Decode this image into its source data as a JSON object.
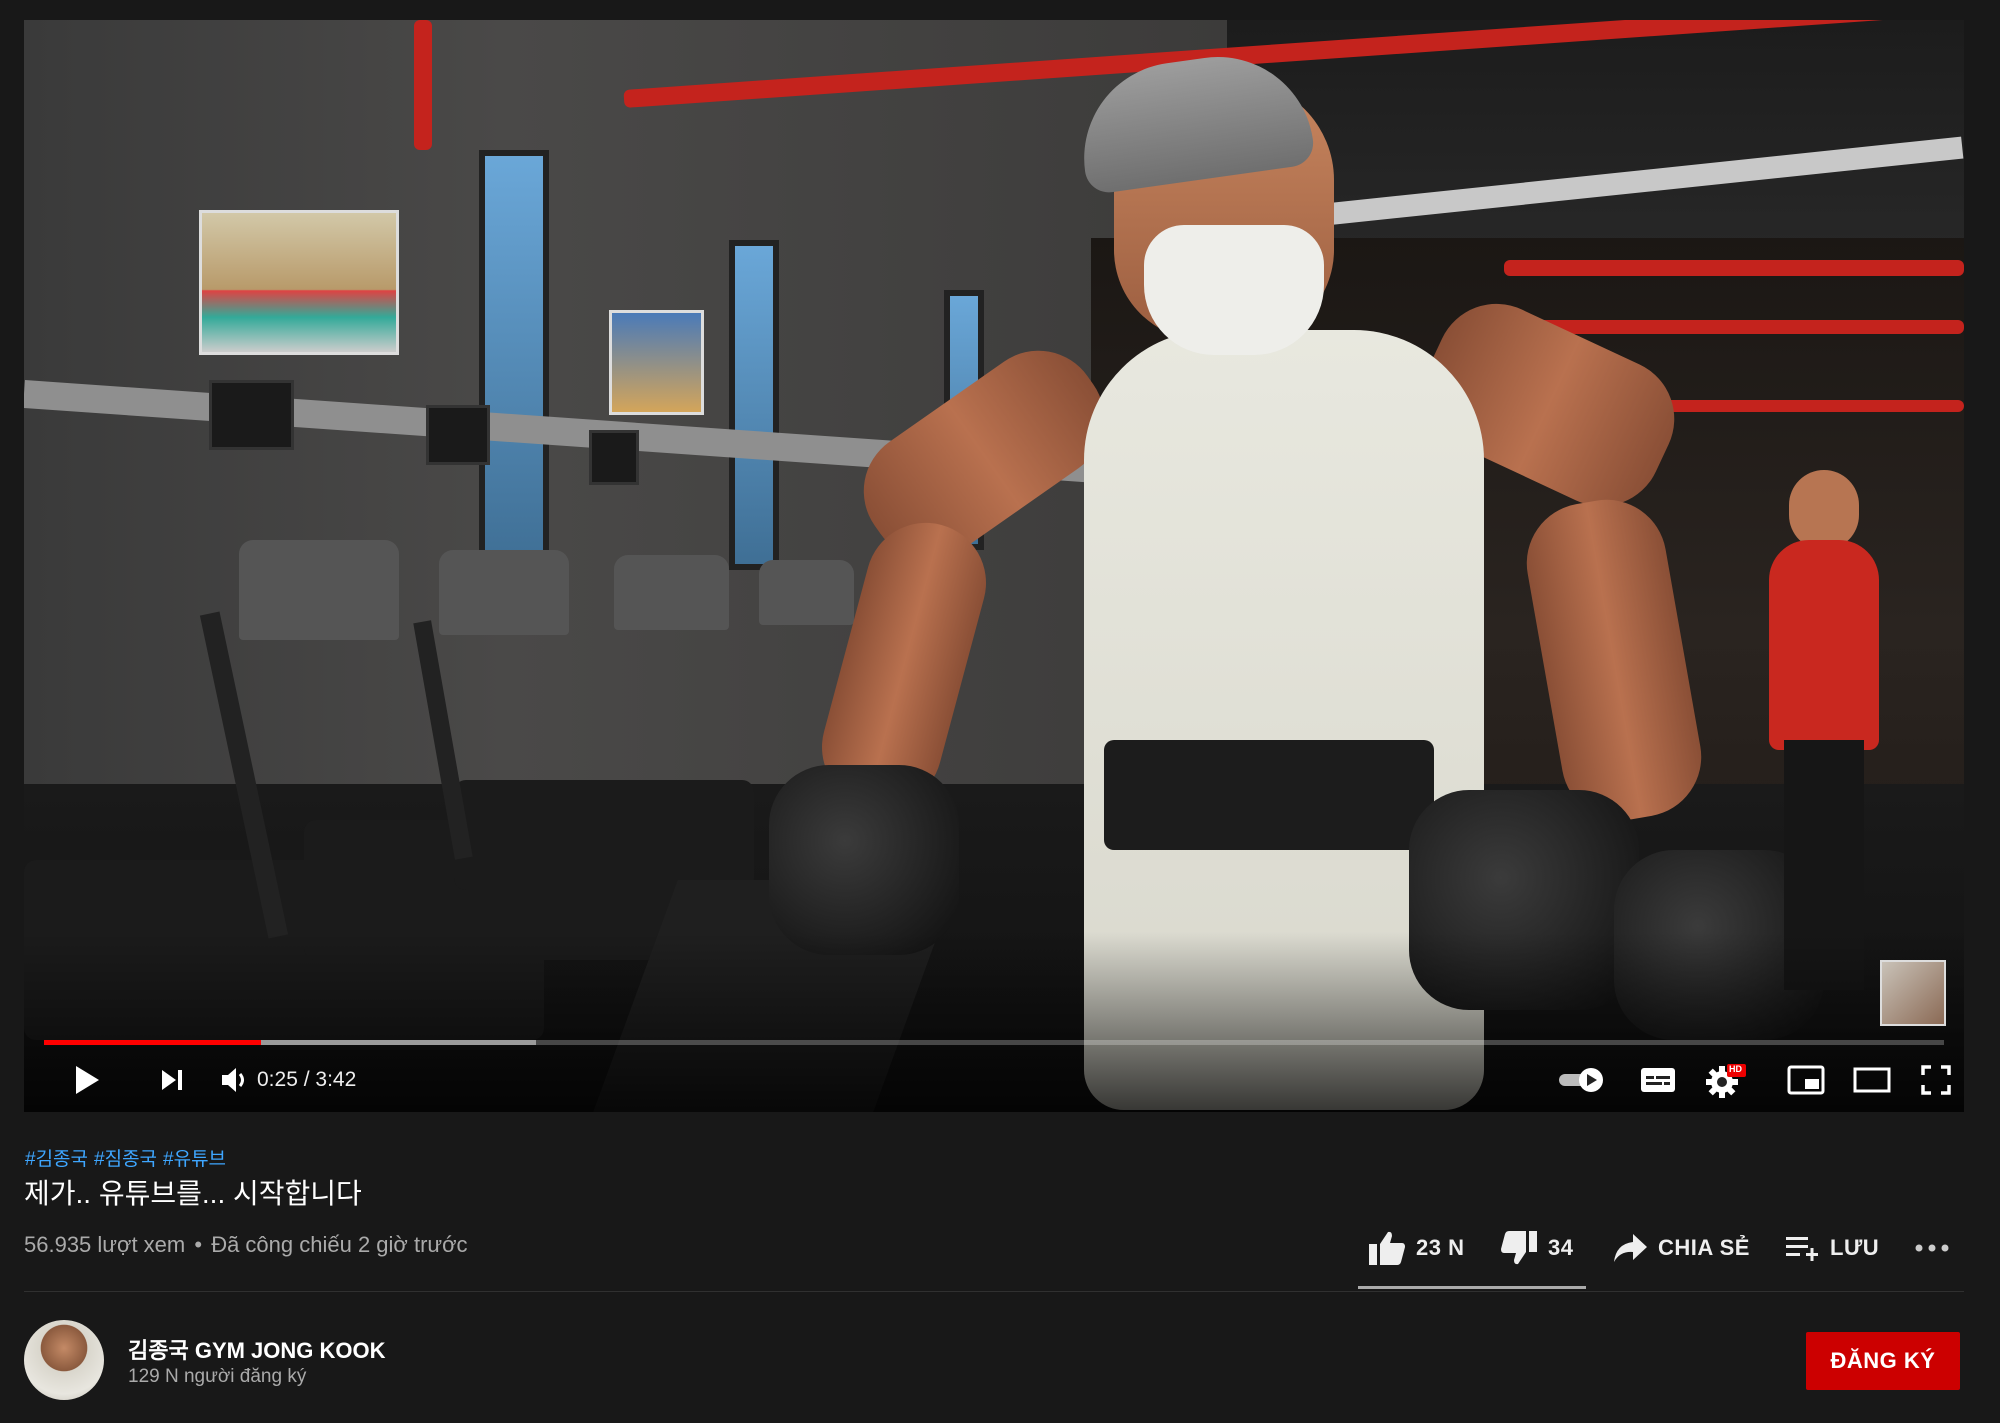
{
  "player": {
    "current_time": "0:25",
    "duration": "3:42",
    "time_separator": " / ",
    "progress_played": 0.114,
    "progress_loaded": 0.259,
    "autoplay_on": true,
    "quality_badge": "HD"
  },
  "video": {
    "hashtags": [
      "#김종국",
      "#짐종국",
      "#유튜브"
    ],
    "title": "제가.. 유튜브를... 시작합니다",
    "views": "56.935 lượt xem",
    "separator": "•",
    "premiered": "Đã công chiếu 2 giờ trước"
  },
  "actions": {
    "like_count": "23 N",
    "dislike_count": "34",
    "share_label": "CHIA SẺ",
    "save_label": "LƯU",
    "like_ratio": 0.998
  },
  "channel": {
    "name": "김종국 GYM JONG KOOK",
    "subscribers": "129 N người đăng ký",
    "subscribe_label": "ĐĂNG KÝ"
  },
  "colors": {
    "accent": "#ff0000",
    "subscribe_bg": "#cc0000",
    "hashtag": "#3ea6ff",
    "background": "#181818"
  }
}
